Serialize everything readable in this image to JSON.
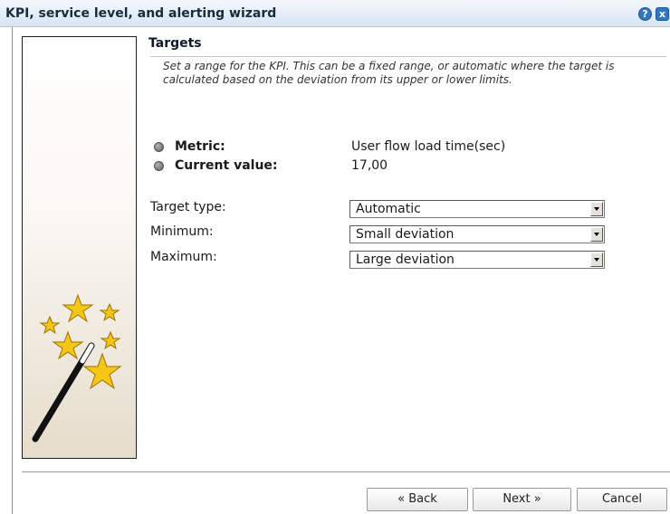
{
  "window": {
    "title": "KPI, service level, and alerting wizard",
    "help_glyph": "?",
    "close_glyph": "x"
  },
  "page": {
    "title": "Targets",
    "description": "Set a range for the KPI. This can be a fixed range, or automatic where the target is calculated based on the deviation from its upper or lower limits."
  },
  "info": {
    "metric_label": "Metric:",
    "metric_value": "User flow load time(sec)",
    "current_label": "Current value:",
    "current_value": "17,00"
  },
  "fields": {
    "target_type_label": "Target type:",
    "target_type_value": "Automatic",
    "minimum_label": "Minimum:",
    "minimum_value": "Small deviation",
    "maximum_label": "Maximum:",
    "maximum_value": "Large deviation"
  },
  "buttons": {
    "back": "« Back",
    "next": "Next »",
    "cancel": "Cancel"
  },
  "icons": {
    "wizard_art": "magic-wand-stars-icon",
    "bullet": "gray-dot-icon",
    "dropdown": "chevron-down-icon"
  },
  "colors": {
    "titlebar": "#d9e5f3",
    "title_buttons": "#2f76c5",
    "stars": "#f5c518"
  }
}
